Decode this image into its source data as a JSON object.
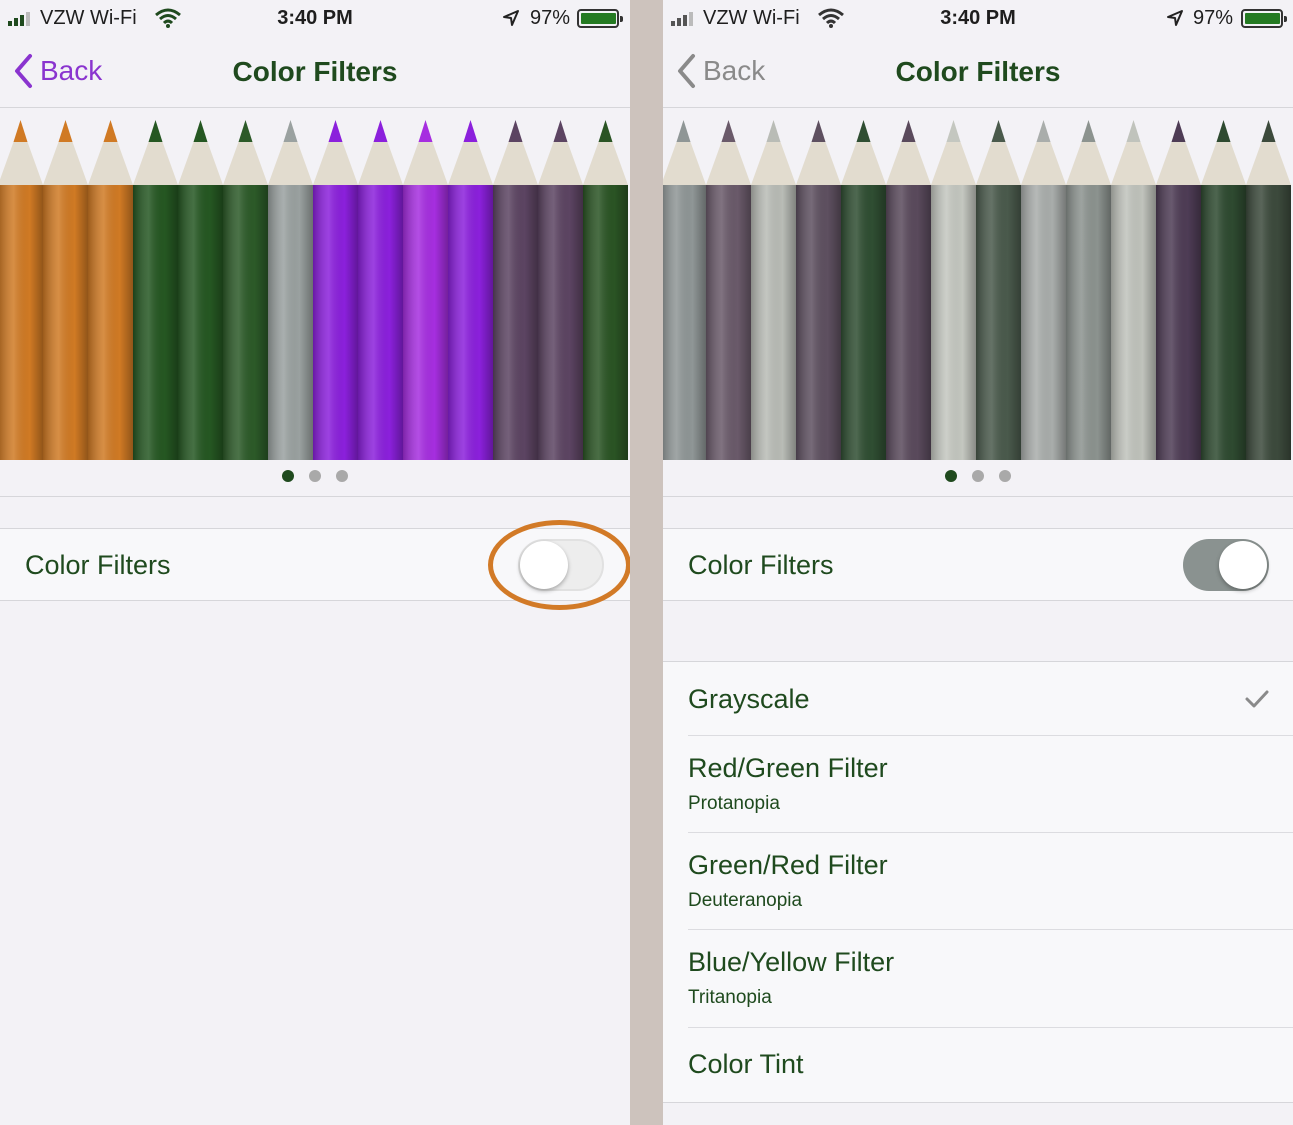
{
  "colors": {
    "accent_left": "#8a34cf",
    "accent_right": "#8a8a8a",
    "text_green": "#1f4a1e",
    "highlight": "#d27a27",
    "switch_on": "#8a9290"
  },
  "left": {
    "status": {
      "carrier": "VZW Wi-Fi",
      "time": "3:40 PM",
      "battery": "97%",
      "battery_level": 0.97
    },
    "nav": {
      "back_label": "Back",
      "title": "Color Filters"
    },
    "carousel": {
      "pages": 3,
      "current_page": 1
    },
    "toggle": {
      "label": "Color Filters",
      "on": false
    }
  },
  "right": {
    "status": {
      "carrier": "VZW Wi-Fi",
      "time": "3:40 PM",
      "battery": "97%",
      "battery_level": 0.97
    },
    "nav": {
      "back_label": "Back",
      "title": "Color Filters"
    },
    "carousel": {
      "pages": 3,
      "current_page": 1
    },
    "toggle": {
      "label": "Color Filters",
      "on": true
    },
    "filters": [
      {
        "name": "Grayscale",
        "subtitle": "",
        "selected": true
      },
      {
        "name": "Red/Green Filter",
        "subtitle": "Protanopia",
        "selected": false
      },
      {
        "name": "Green/Red Filter",
        "subtitle": "Deuteranopia",
        "selected": false
      },
      {
        "name": "Blue/Yellow Filter",
        "subtitle": "Tritanopia",
        "selected": false
      },
      {
        "name": "Color Tint",
        "subtitle": "",
        "selected": false
      }
    ]
  }
}
